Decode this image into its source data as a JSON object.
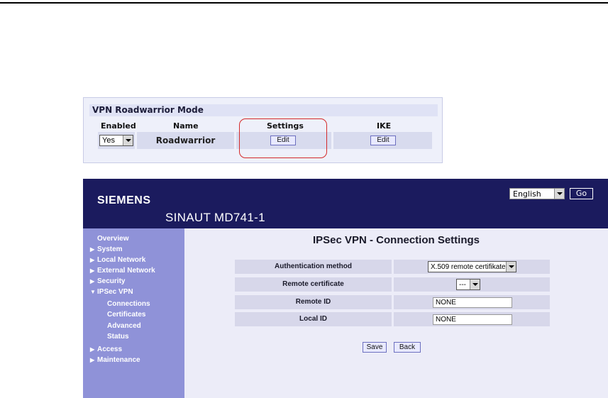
{
  "roadwarrior": {
    "title": "VPN Roadwarrior Mode",
    "headers": {
      "enabled": "Enabled",
      "name": "Name",
      "settings": "Settings",
      "ike": "IKE"
    },
    "enabled_value": "Yes",
    "name_value": "Roadwarrior",
    "settings_button": "Edit",
    "ike_button": "Edit",
    "highlight_color": "#d42a2a"
  },
  "app": {
    "brand": "SIEMENS",
    "product": "SINAUT MD741-1",
    "language": "English",
    "go_label": "Go",
    "colors": {
      "header": "#1b1b5e",
      "sidebar": "#8f92d8",
      "content": "#ececf8"
    }
  },
  "nav": {
    "overview": "Overview",
    "system": "System",
    "local_network": "Local Network",
    "external_network": "External Network",
    "security": "Security",
    "ipsec_vpn": "IPSec VPN",
    "connections": "Connections",
    "certificates": "Certificates",
    "advanced": "Advanced",
    "status": "Status",
    "access": "Access",
    "maintenance": "Maintenance"
  },
  "form": {
    "title": "IPSec VPN - Connection Settings",
    "auth_label": "Authentication method",
    "auth_value": "X.509 remote certifikate",
    "cert_label": "Remote certificate",
    "cert_value": "---",
    "remote_id_label": "Remote ID",
    "remote_id_value": "NONE",
    "local_id_label": "Local ID",
    "local_id_value": "NONE",
    "save_label": "Save",
    "back_label": "Back"
  }
}
